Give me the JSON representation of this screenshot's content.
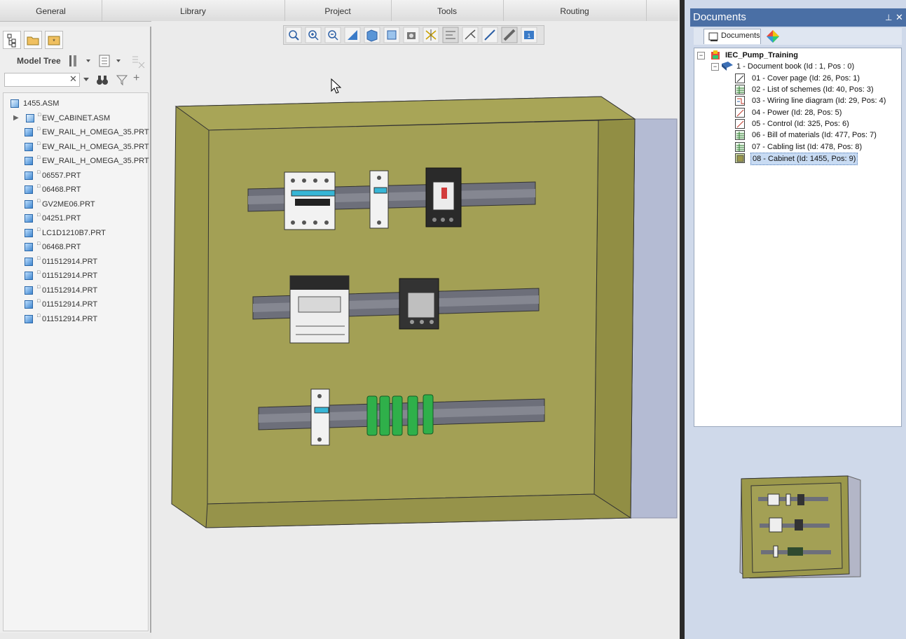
{
  "ribbon": {
    "tabs": [
      {
        "label": "General"
      },
      {
        "label": "Library"
      },
      {
        "label": "Project"
      },
      {
        "label": "Tools"
      },
      {
        "label": "Routing"
      }
    ]
  },
  "left_panel": {
    "model_tree_label": "Model Tree",
    "search": {
      "value": "",
      "placeholder": ""
    },
    "tree": [
      {
        "label": "1455.ASM",
        "level": 0,
        "kind": "asm"
      },
      {
        "label": "EW_CABINET.ASM",
        "level": 1,
        "kind": "asm",
        "expandable": true
      },
      {
        "label": "EW_RAIL_H_OMEGA_35.PRT",
        "level": 1,
        "kind": "prt"
      },
      {
        "label": "EW_RAIL_H_OMEGA_35.PRT",
        "level": 1,
        "kind": "prt"
      },
      {
        "label": "EW_RAIL_H_OMEGA_35.PRT",
        "level": 1,
        "kind": "prt"
      },
      {
        "label": "06557.PRT",
        "level": 1,
        "kind": "prt"
      },
      {
        "label": "06468.PRT",
        "level": 1,
        "kind": "prt"
      },
      {
        "label": "GV2ME06.PRT",
        "level": 1,
        "kind": "prt"
      },
      {
        "label": "04251.PRT",
        "level": 1,
        "kind": "prt"
      },
      {
        "label": "LC1D1210B7.PRT",
        "level": 1,
        "kind": "prt"
      },
      {
        "label": "06468.PRT",
        "level": 1,
        "kind": "prt"
      },
      {
        "label": "011512914.PRT",
        "level": 1,
        "kind": "prt"
      },
      {
        "label": "011512914.PRT",
        "level": 1,
        "kind": "prt"
      },
      {
        "label": "011512914.PRT",
        "level": 1,
        "kind": "prt"
      },
      {
        "label": "011512914.PRT",
        "level": 1,
        "kind": "prt"
      },
      {
        "label": "011512914.PRT",
        "level": 1,
        "kind": "prt"
      }
    ]
  },
  "viewport_toolbar": [
    {
      "icon": "zoom-fit-icon"
    },
    {
      "icon": "zoom-in-icon"
    },
    {
      "icon": "zoom-out-icon"
    },
    {
      "icon": "repaint-icon"
    },
    {
      "icon": "saved-views-icon"
    },
    {
      "icon": "view-manager-icon"
    },
    {
      "icon": "display-style-icon"
    },
    {
      "icon": "datum-display-icon"
    },
    {
      "icon": "spin-center-icon"
    },
    {
      "icon": "axis-display-icon"
    },
    {
      "icon": "point-display-icon"
    },
    {
      "icon": "csys-display-icon"
    },
    {
      "icon": "annotation-display-icon"
    }
  ],
  "documents_panel": {
    "title": "Documents",
    "tab_label": "Documents",
    "project": "IEC_Pump_Training",
    "book": "1 - Document book (Id : 1, Pos : 0)",
    "items": [
      {
        "label": "01 - Cover page (Id: 26, Pos: 1)",
        "icon": "cover-page-icon"
      },
      {
        "label": "02 - List of schemes (Id: 40, Pos: 3)",
        "icon": "list-icon"
      },
      {
        "label": "03 - Wiring line diagram (Id: 29, Pos: 4)",
        "icon": "wiring-diagram-icon"
      },
      {
        "label": "04 - Power (Id: 28, Pos: 5)",
        "icon": "schematic-icon"
      },
      {
        "label": "05 - Control (Id: 325, Pos: 6)",
        "icon": "schematic-icon"
      },
      {
        "label": "06 - Bill of materials (Id: 477, Pos: 7)",
        "icon": "list-icon"
      },
      {
        "label": "07 - Cabling list (Id: 478, Pos: 8)",
        "icon": "list-icon"
      },
      {
        "label": "08 - Cabinet (Id: 1455, Pos: 9)",
        "icon": "cabinet-icon",
        "selected": true
      }
    ]
  },
  "colors": {
    "cabinet": "#9f9b4e",
    "cabinet_face": "#a3a055",
    "rail": "#6d6f7a",
    "terminal_green": "#2fb04a",
    "title_bar": "#4a6fa5",
    "selection": "#c8dbf3"
  }
}
